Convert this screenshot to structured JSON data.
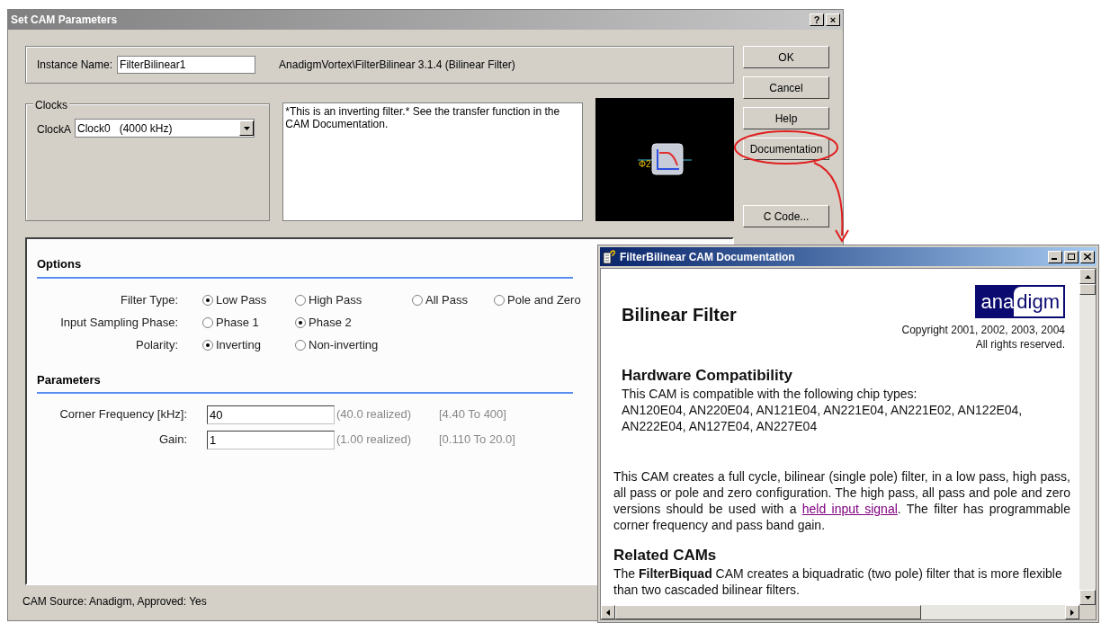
{
  "dialog": {
    "title": "Set CAM Parameters",
    "title_buttons": [
      "?",
      "×"
    ],
    "instance": {
      "label": "Instance Name:",
      "value": "FilterBilinear1",
      "path": "AnadigmVortex\\FilterBilinear 3.1.4 (Bilinear Filter)"
    },
    "clocks": {
      "legend": "Clocks",
      "label": "ClockA",
      "value": "Clock0   (4000 kHz)"
    },
    "description": "*This is an inverting filter.*  See the transfer function in the CAM Documentation.",
    "preview": {
      "phase_label": "Φ2"
    },
    "buttons": [
      "OK",
      "Cancel",
      "Help",
      "Documentation",
      "C Code..."
    ],
    "options": {
      "heading": "Options",
      "rows": [
        {
          "label": "Filter Type:",
          "choices": [
            {
              "label": "Low Pass",
              "selected": true
            },
            {
              "label": "High Pass",
              "selected": false
            },
            {
              "label": "All Pass",
              "selected": false
            },
            {
              "label": "Pole and Zero",
              "selected": false
            }
          ]
        },
        {
          "label": "Input Sampling Phase:",
          "choices": [
            {
              "label": "Phase 1",
              "selected": false
            },
            {
              "label": "Phase 2",
              "selected": true
            }
          ]
        },
        {
          "label": "Polarity:",
          "choices": [
            {
              "label": "Inverting",
              "selected": true
            },
            {
              "label": "Non-inverting",
              "selected": false
            }
          ]
        }
      ]
    },
    "parameters": {
      "heading": "Parameters",
      "rows": [
        {
          "label": "Corner Frequency [kHz]:",
          "value": "40",
          "realized": "(40.0 realized)",
          "range": "[4.40 To 400]"
        },
        {
          "label": "Gain:",
          "value": "1",
          "realized": "(1.00 realized)",
          "range": "[0.110 To 20.0]"
        }
      ]
    },
    "status": "CAM Source: Anadigm, Approved: Yes"
  },
  "doc_window": {
    "title": "FilterBilinear CAM Documentation",
    "heading": "Bilinear Filter",
    "logo": [
      "ana",
      "digm"
    ],
    "copyright": [
      "Copyright 2001, 2002, 2003, 2004",
      "All rights reserved."
    ],
    "compat_heading": "Hardware Compatibility",
    "compat_lines": [
      "This CAM is compatible with the following chip types:",
      "AN120E04, AN220E04, AN121E04, AN221E04, AN221E02, AN122E04,",
      "AN222E04, AN127E04, AN227E04"
    ],
    "paragraph_before": "This CAM creates a full cycle, bilinear (single pole) filter, in a low pass, high pass, all pass or pole and zero configuration.  The high pass, all pass and pole and zero versions should be used with a",
    "link": "held input signal",
    "paragraph_after": ".  The filter has programmable corner frequency and pass band gain.",
    "related_heading": "Related CAMs",
    "related_text": "The **FilterBiquad** CAM creates a biquadratic (two pole) filter that is more flexible than two cascaded bilinear filters."
  }
}
